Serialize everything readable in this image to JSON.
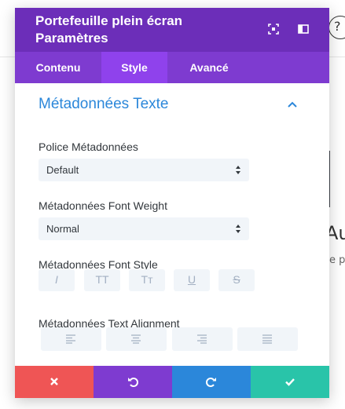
{
  "background": {
    "help_glyph": "?",
    "heading_fragment": "Au",
    "text_fragment": "e pa"
  },
  "modal": {
    "title": "Portefeuille plein écran Paramètres",
    "header_icons": [
      "fullscreen-icon",
      "sidebar-icon"
    ],
    "tabs": [
      {
        "label": "Contenu",
        "active": false
      },
      {
        "label": "Style",
        "active": true
      },
      {
        "label": "Avancé",
        "active": false
      }
    ],
    "section": {
      "title": "Métadonnées Texte",
      "collapse_icon": "chevron-up-icon",
      "fields": {
        "font": {
          "label": "Police Métadonnées",
          "value": "Default"
        },
        "weight": {
          "label": "Métadonnées Font Weight",
          "value": "Normal"
        },
        "style": {
          "label": "Métadonnées Font Style",
          "buttons": [
            {
              "name": "italic",
              "glyph": "I"
            },
            {
              "name": "uppercase",
              "glyph": "TT"
            },
            {
              "name": "capitalize",
              "glyph": "Tт"
            },
            {
              "name": "underline",
              "glyph": "U"
            },
            {
              "name": "strikethrough",
              "glyph": "S"
            }
          ]
        },
        "alignment": {
          "label": "Métadonnées Text Alignment",
          "buttons": [
            "align-left-icon",
            "align-center-icon",
            "align-right-icon",
            "align-justify-icon"
          ]
        }
      }
    },
    "footer": {
      "colors": {
        "cancel": "#ef5555",
        "undo": "#7e3bd0",
        "redo": "#2b87da",
        "save": "#29c4a9"
      },
      "icons": [
        "close-icon",
        "undo-icon",
        "redo-icon",
        "check-icon"
      ]
    },
    "colors": {
      "header": "#6c2eb9",
      "tabs": "#7e3bd0",
      "active_tab": "#8f42ec",
      "accent": "#2b87da"
    }
  }
}
